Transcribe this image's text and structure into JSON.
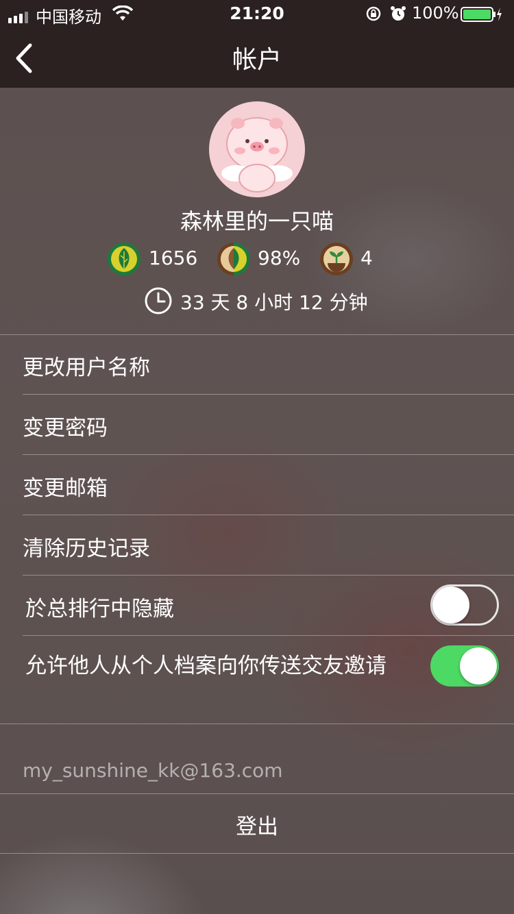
{
  "status": {
    "carrier": "中国移动",
    "time": "21:20",
    "battery": "100%",
    "signal_icon": "signal-bars-icon",
    "wifi_icon": "wifi-icon",
    "lock_icon": "rotation-lock-icon",
    "alarm_icon": "alarm-icon",
    "battery_icon": "battery-icon",
    "battery_level": 1.0
  },
  "nav": {
    "title": "帐户",
    "back_icon": "chevron-left-icon"
  },
  "profile": {
    "username": "森林里的一只喵",
    "stats": [
      {
        "icon": "healthy-tree-icon",
        "value": "1656"
      },
      {
        "icon": "half-withered-tree-icon",
        "value": "98%"
      },
      {
        "icon": "sprout-icon",
        "value": "4"
      }
    ],
    "time_total": "33 天 8 小时 12 分钟",
    "clock_icon": "clock-icon"
  },
  "menu": {
    "change_username": "更改用户名称",
    "change_password": "变更密码",
    "change_email": "变更邮箱",
    "clear_history": "清除历史记录",
    "hide_ranking": "於总排行中隐藏",
    "hide_ranking_on": false,
    "allow_friend_invite": "允许他人从个人档案向你传送交友邀请",
    "allow_friend_invite_on": true
  },
  "account": {
    "email": "my_sunshine_kk@163.com",
    "logout": "登出"
  },
  "colors": {
    "bar_bg": "#2a2120",
    "toggle_on": "#4cd964",
    "battery_green": "#4cd964"
  }
}
